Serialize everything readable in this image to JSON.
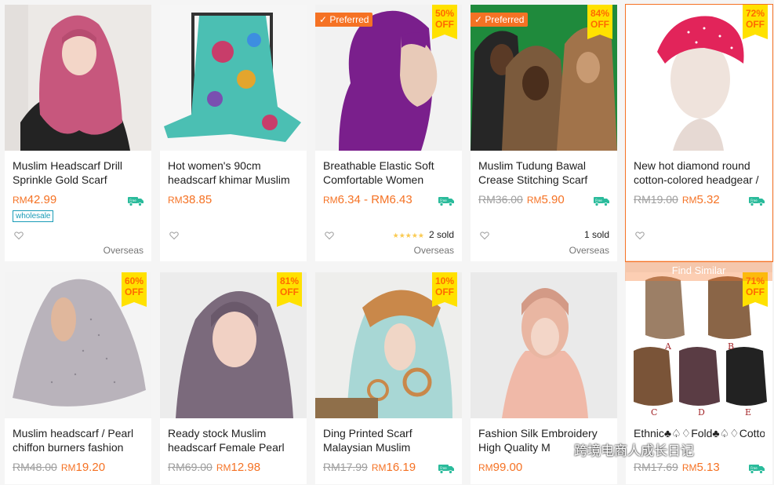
{
  "products": [
    {
      "title": "Muslim Headscarf Drill Sprinkle Gold Scarf",
      "price": "42.99",
      "old_price": "",
      "preferred": false,
      "discount": "",
      "tag": "wholesale",
      "sold": "",
      "stars": false,
      "location": "Overseas",
      "free_shipping": true,
      "img": "pink-hijab"
    },
    {
      "title": "Hot women's 90cm headscarf khimar Muslim",
      "price": "38.85",
      "old_price": "",
      "preferred": false,
      "discount": "",
      "tag": "",
      "sold": "",
      "stars": false,
      "location": "",
      "free_shipping": false,
      "img": "silk-scarf"
    },
    {
      "title": "Breathable Elastic Soft Comfortable Women",
      "price": "6.34 - RM6.43",
      "old_price": "",
      "preferred": true,
      "discount": "50%",
      "tag": "",
      "sold": "2 sold",
      "stars": true,
      "location": "Overseas",
      "free_shipping": true,
      "img": "purple-cap"
    },
    {
      "title": "Muslim Tudung Bawal Crease Stitching Scarf",
      "price": "5.90",
      "old_price": "36.00",
      "preferred": true,
      "discount": "84%",
      "tag": "",
      "sold": "1 sold",
      "stars": false,
      "location": "Overseas",
      "free_shipping": true,
      "img": "three-women"
    },
    {
      "title": "New hot diamond round cotton-colored headgear /",
      "price": "5.32",
      "old_price": "19.00",
      "preferred": false,
      "discount": "72%",
      "tag": "",
      "sold": "",
      "stars": false,
      "location": "",
      "free_shipping": true,
      "img": "pink-turban"
    },
    {
      "title": "Muslim headscarf / Pearl chiffon burners fashion",
      "price": "19.20",
      "old_price": "48.00",
      "preferred": false,
      "discount": "60%",
      "tag": "",
      "sold": "",
      "stars": false,
      "location": "",
      "free_shipping": false,
      "img": "grey-hijab"
    },
    {
      "title": "Ready stock Muslim headscarf Female Pearl",
      "price": "12.98",
      "old_price": "69.00",
      "preferred": false,
      "discount": "81%",
      "tag": "",
      "sold": "",
      "stars": false,
      "location": "",
      "free_shipping": false,
      "img": "mauve-hijab"
    },
    {
      "title": "Ding Printed Scarf Malaysian Muslim",
      "price": "16.19",
      "old_price": "17.99",
      "preferred": false,
      "discount": "10%",
      "tag": "",
      "sold": "",
      "stars": false,
      "location": "",
      "free_shipping": true,
      "img": "printed-scarf"
    },
    {
      "title": "Fashion Silk Embroidery High Quality M",
      "price": "99.00",
      "old_price": "",
      "preferred": false,
      "discount": "",
      "tag": "",
      "sold": "",
      "stars": false,
      "location": "",
      "free_shipping": false,
      "img": "peach-hijab"
    },
    {
      "title": "Ethnic♣♤♢Fold♣♤♢Cotton",
      "price": "5.13",
      "old_price": "17.69",
      "preferred": false,
      "discount": "71%",
      "tag": "",
      "sold": "",
      "stars": false,
      "location": "",
      "free_shipping": true,
      "img": "five-scarves"
    }
  ],
  "labels": {
    "currency": "RM",
    "preferred": "✓ Preferred",
    "off": "OFF",
    "free": "Free",
    "find_similar": "Find Similar",
    "watermark": "跨境电商人成长日记",
    "scarf_letters": [
      "A",
      "B",
      "C",
      "D",
      "E"
    ]
  },
  "colors": {
    "accent": "#f57224",
    "badge": "#ffe100",
    "link": "#1a9cb7"
  }
}
